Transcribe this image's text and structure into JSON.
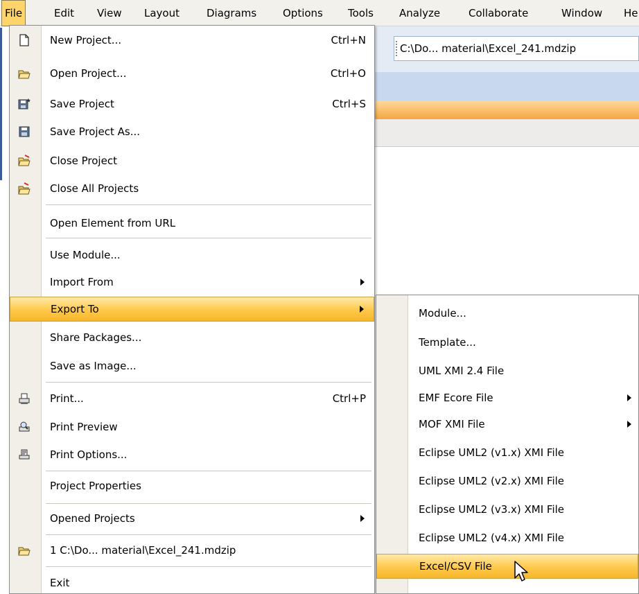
{
  "menubar": {
    "items": [
      {
        "label": "File",
        "active": true
      },
      {
        "label": "Edit"
      },
      {
        "label": "View"
      },
      {
        "label": "Layout"
      },
      {
        "label": "Diagrams"
      },
      {
        "label": "Options"
      },
      {
        "label": "Tools"
      },
      {
        "label": "Analyze"
      },
      {
        "label": "Collaborate"
      },
      {
        "label": "Window"
      },
      {
        "label": "He"
      }
    ]
  },
  "toolbar": {
    "project_path": "C:\\Do... material\\Excel_241.mdzip"
  },
  "file_menu": {
    "items": [
      {
        "label": "New Project...",
        "shortcut": "Ctrl+N",
        "icon": "new-project-icon"
      },
      {
        "label": "Open Project...",
        "shortcut": "Ctrl+O",
        "icon": "open-folder-icon"
      },
      {
        "label": "Save Project",
        "shortcut": "Ctrl+S",
        "icon": "save-star-icon"
      },
      {
        "label": "Save Project As...",
        "icon": "save-icon"
      },
      {
        "label": "Close Project",
        "icon": "close-folder-icon"
      },
      {
        "label": "Close All Projects",
        "icon": "close-all-folders-icon"
      },
      {
        "label": "Open Element from URL"
      },
      {
        "label": "Use Module..."
      },
      {
        "label": "Import From",
        "submenu": true
      },
      {
        "label": "Export To",
        "submenu": true,
        "highlighted": true
      },
      {
        "label": "Share Packages..."
      },
      {
        "label": "Save as Image..."
      },
      {
        "label": "Print...",
        "shortcut": "Ctrl+P",
        "icon": "printer-icon"
      },
      {
        "label": "Print Preview",
        "icon": "print-preview-icon"
      },
      {
        "label": "Print Options...",
        "icon": "print-options-icon"
      },
      {
        "label": "Project Properties"
      },
      {
        "label": "Opened Projects",
        "submenu": true
      },
      {
        "label": "1 C:\\Do... material\\Excel_241.mdzip",
        "icon": "recent-project-icon"
      },
      {
        "label": "Exit"
      }
    ]
  },
  "export_submenu": {
    "items": [
      {
        "label": "Module..."
      },
      {
        "label": "Template..."
      },
      {
        "label": "UML XMI 2.4 File"
      },
      {
        "label": "EMF Ecore File",
        "submenu": true
      },
      {
        "label": "MOF XMI File",
        "submenu": true
      },
      {
        "label": "Eclipse UML2 (v1.x) XMI File"
      },
      {
        "label": "Eclipse UML2 (v2.x) XMI File"
      },
      {
        "label": "Eclipse UML2 (v3.x) XMI File"
      },
      {
        "label": "Eclipse UML2 (v4.x) XMI File"
      },
      {
        "label": "Excel/CSV File",
        "highlighted": true
      }
    ]
  },
  "colors": {
    "highlight": "#ffc84a",
    "menubar_active": "#ffd46a",
    "icon_column": "#f1efe8"
  }
}
